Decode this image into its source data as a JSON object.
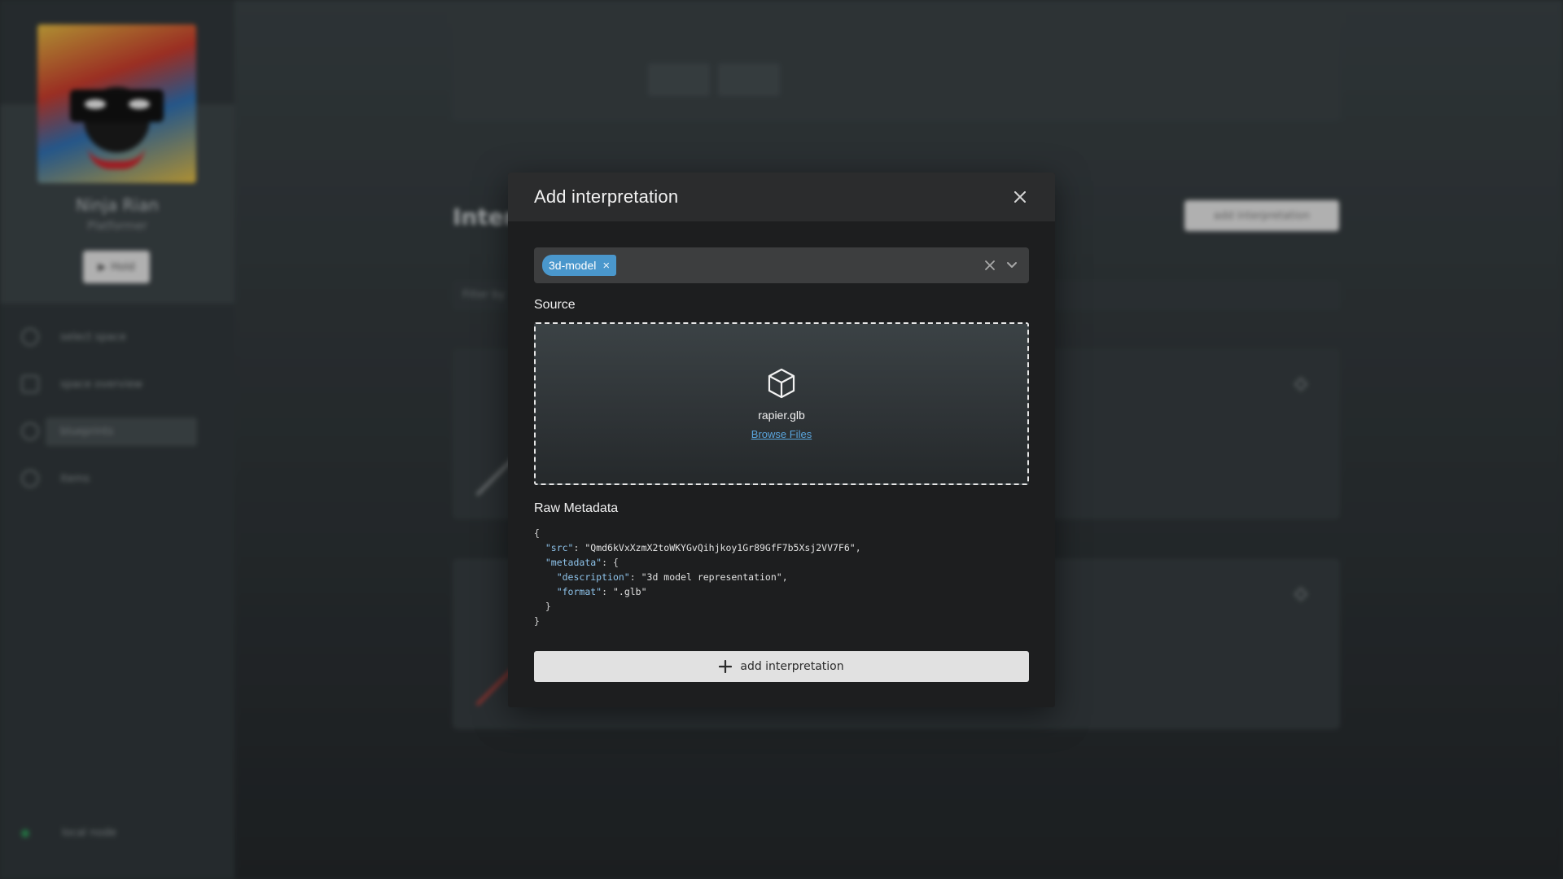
{
  "background": {
    "profile": {
      "name": "Ninja Rian",
      "role": "Platformer",
      "button_label": "Hold"
    },
    "nav": [
      {
        "label": "select space"
      },
      {
        "label": "space overview"
      },
      {
        "label": "blueprints"
      },
      {
        "label": "items"
      }
    ],
    "footer_label": "local node",
    "heading": "Interp",
    "add_button_label": "add interpretation",
    "filter_placeholder": "Filter by"
  },
  "modal": {
    "title": "Add interpretation",
    "type_select": {
      "selected_tags": [
        "3d-model"
      ]
    },
    "source_label": "Source",
    "dropzone": {
      "file_name": "rapier.glb",
      "browse_label": "Browse Files"
    },
    "metadata_label": "Raw Metadata",
    "raw_metadata": {
      "src": "Qmd6kVxXzmX2toWKYGvQihjkoy1Gr89GfF7b5Xsj2VV7F6",
      "description": "3d model representation",
      "format": ".glb"
    },
    "submit_label": "add interpretation"
  },
  "colors": {
    "tag_bg": "#4a97cc",
    "link": "#5aa5dd",
    "modal_bg": "#1d1e1f",
    "header_bg": "#2b2c2d",
    "button_bg": "#e1e1e1"
  },
  "icons": {
    "close": "close-icon",
    "clear": "clear-icon",
    "dropdown": "chevron-down-icon",
    "file": "cube-icon",
    "submit": "plus-icon"
  }
}
